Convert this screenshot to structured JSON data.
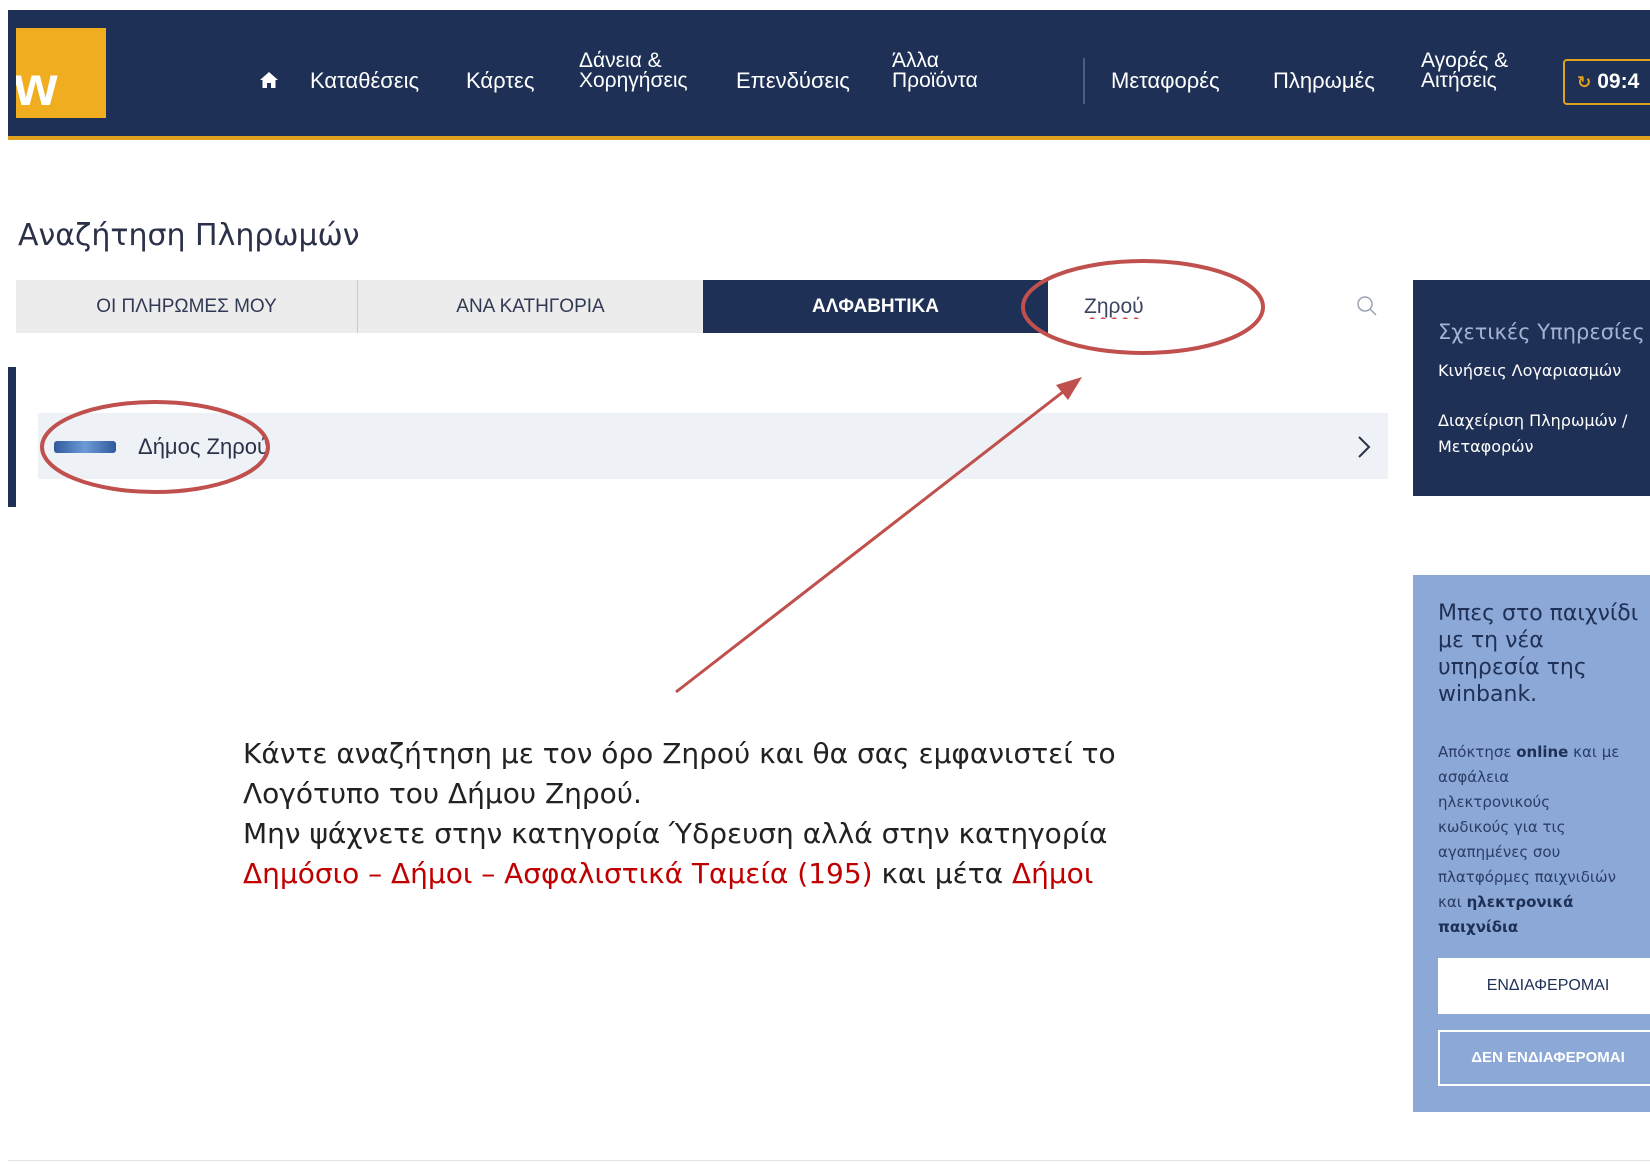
{
  "nav": {
    "logo_text": "w",
    "items": [
      {
        "label": "Καταθέσεις"
      },
      {
        "label": "Κάρτες"
      },
      {
        "line1": "Δάνεια &",
        "line2": "Χορηγήσεις"
      },
      {
        "label": "Επενδύσεις"
      },
      {
        "line1": "Άλλα",
        "line2": "Προϊόντα"
      },
      {
        "label": "Μεταφορές"
      },
      {
        "label": "Πληρωμές"
      },
      {
        "line1": "Αγορές &",
        "line2": "Αιτήσεις"
      }
    ],
    "timer": "09:4"
  },
  "page": {
    "title": "Αναζήτηση Πληρωμών"
  },
  "tabs": [
    {
      "label": "ΟΙ ΠΛΗΡΩΜΕΣ ΜΟΥ",
      "active": false
    },
    {
      "label": "ΑΝΑ ΚΑΤΗΓΟΡΙΑ",
      "active": false
    },
    {
      "label": "ΑΛΦΑΒΗΤΙΚΑ",
      "active": true
    }
  ],
  "search": {
    "value": "Ζηρού"
  },
  "results": [
    {
      "label": "Δήμος Ζηρού"
    }
  ],
  "related": {
    "title": "Σχετικές Υπηρεσίες",
    "links": [
      {
        "label": "Κινήσεις Λογαριασμών"
      },
      {
        "line1": "Διαχείριση Πληρωμών /",
        "line2": "Μεταφορών"
      }
    ]
  },
  "promo": {
    "heading": [
      "Μπες στο παιχνίδι",
      "με τη νέα",
      "υπηρεσία της",
      "winbank."
    ],
    "body": {
      "p1": "Απόκτησε ",
      "b1": "online",
      "p2": " και με",
      "lines": [
        "ασφάλεια",
        "ηλεκτρονικούς",
        "κωδικούς για τις",
        "αγαπημένες σου",
        "πλατφόρμες παιχνιδιών"
      ],
      "p3": "και ",
      "b2": "ηλεκτρονικά",
      "b3": "παιχνίδια"
    },
    "btn_interested": "ΕΝΔΙΑΦΕΡΟΜΑΙ",
    "btn_not_interested": "ΔΕΝ ΕΝΔΙΑΦΕΡΟΜΑΙ"
  },
  "annotation": {
    "line1": "Κάντε αναζήτηση με τον όρο Ζηρού και θα σας εμφανιστεί το",
    "line2": "Λογότυπο του Δήμου Ζηρού.",
    "line3": "Μην ψάχνετε στην κατηγορία Ύδρευση αλλά στην κατηγορία",
    "line4_red1": "Δημόσιο – Δήμοι – Ασφαλιστικά Ταμεία (195)",
    "line4_mid": " και μέτα ",
    "line4_red2": "Δήμοι",
    "color": "#c00000"
  }
}
